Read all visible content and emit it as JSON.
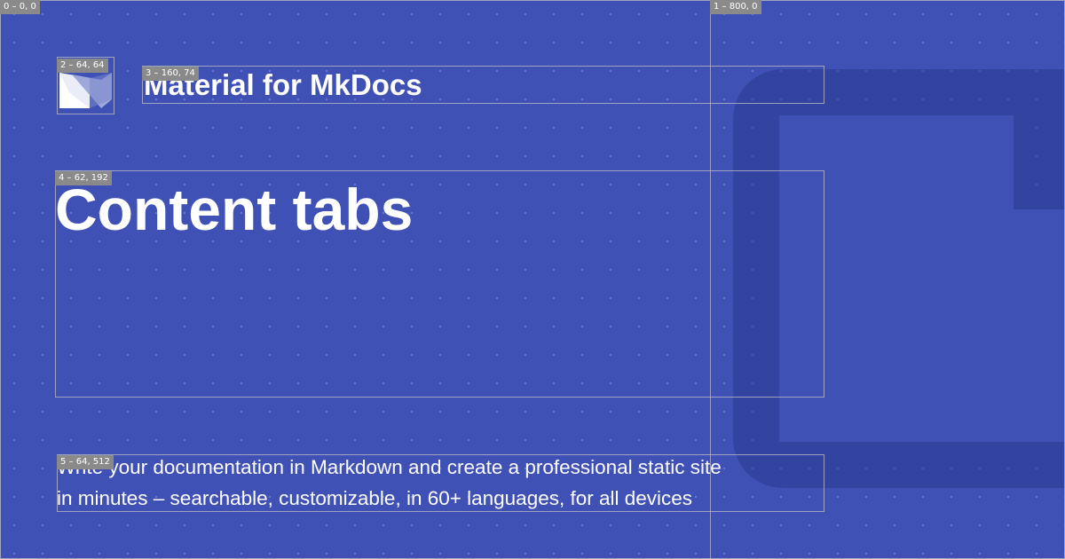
{
  "card": {
    "site_name": "Material for MkDocs",
    "page_title": "Content tabs",
    "description_lines": [
      "Write your documentation in Markdown and create a professional static site",
      "in minutes – searchable, customizable, in 60+ languages, for all devices"
    ],
    "logo_icon": "material-mkdocs-logo-icon"
  },
  "annotations": [
    {
      "label": "0 – 0, 0"
    },
    {
      "label": "1 – 800, 0"
    },
    {
      "label": "2 – 64, 64"
    },
    {
      "label": "3 – 160, 74"
    },
    {
      "label": "4 – 62, 192"
    },
    {
      "label": "5 – 64, 512"
    }
  ],
  "colors": {
    "background": "#3f51b5",
    "text": "#ffffff",
    "decoration": "#2f3f96",
    "annotation_tag": "#8a8a8a"
  }
}
